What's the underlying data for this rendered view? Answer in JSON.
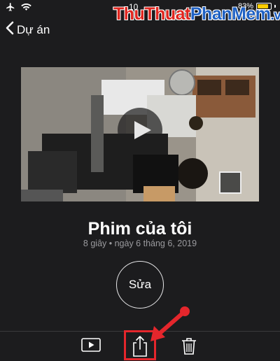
{
  "status_bar": {
    "time": "10",
    "battery_text": "83%",
    "icons": [
      "airplane-icon",
      "wifi-icon",
      "battery-icon"
    ]
  },
  "watermark": {
    "part1": "Thu",
    "part2": "Thuat",
    "part3": "Phan",
    "part4": "Mem",
    "part5": ".vn"
  },
  "nav": {
    "back_label": "Dự án",
    "back_icon": "chevron-left-icon"
  },
  "project": {
    "title": "Phim của tôi",
    "meta": "8 giây • ngày 6 tháng 6, 2019",
    "edit_label": "Sửa"
  },
  "toolbar": {
    "icons": [
      "play-icon",
      "share-icon",
      "trash-icon"
    ]
  },
  "colors": {
    "background": "#1c1c1e",
    "highlight": "#e4262c",
    "meta_text": "#9a9a9e",
    "battery": "#ffcc00"
  }
}
